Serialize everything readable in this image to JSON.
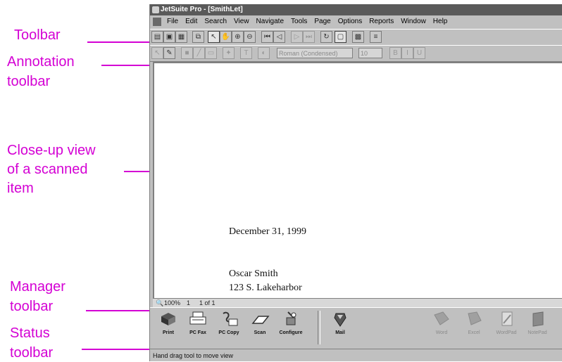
{
  "callouts": {
    "toolbar": "Toolbar",
    "annotation_1": "Annotation",
    "annotation_2": "toolbar",
    "closeup_1": "Close-up view",
    "closeup_2": "of a scanned",
    "closeup_3": "item",
    "manager_1": "Manager",
    "manager_2": "toolbar",
    "status_1": "Status",
    "status_2": "toolbar"
  },
  "window": {
    "title": "JetSuite Pro - [SmithLet]"
  },
  "menu": [
    "File",
    "Edit",
    "Search",
    "View",
    "Navigate",
    "Tools",
    "Page",
    "Options",
    "Reports",
    "Window",
    "Help"
  ],
  "annotation": {
    "font_value": "Roman (Condensed)",
    "size_value": "10"
  },
  "document": {
    "date": "December 31, 1999",
    "name": "Oscar Smith",
    "address": "123 S. Lakeharbor"
  },
  "zoom_bar": {
    "zoom": "100%",
    "page": "1",
    "of": "1 of 1"
  },
  "manager": {
    "print": "Print",
    "pc_fax": "PC Fax",
    "pc_copy": "PC Copy",
    "scan": "Scan",
    "configure": "Configure",
    "mail": "Mail",
    "word": "Word",
    "excel": "Excel",
    "wordpad": "WordPad",
    "notepad": "NotePad"
  },
  "status": {
    "text": "Hand drag tool to move view"
  },
  "colors": {
    "callout": "#d400d4",
    "titlebar": "#5a5a5a",
    "chrome": "#c0c0c0"
  }
}
